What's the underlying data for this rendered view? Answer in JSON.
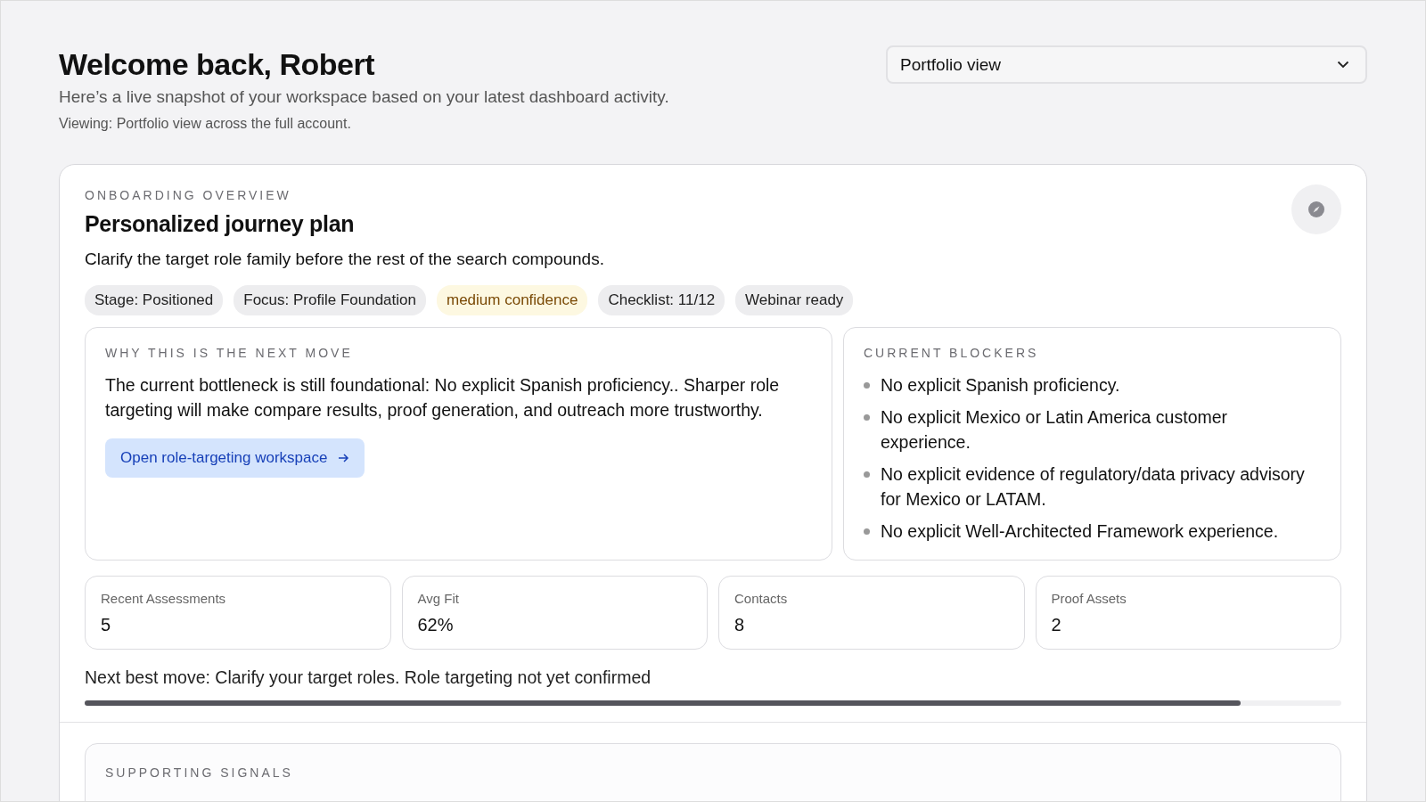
{
  "header": {
    "title": "Welcome back, Robert",
    "subtitle": "Here’s a live snapshot of your workspace based on your latest dashboard activity.",
    "viewing": "Viewing: Portfolio view across the full account."
  },
  "view_select": {
    "value": "Portfolio view"
  },
  "overview": {
    "eyebrow": "ONBOARDING OVERVIEW",
    "title": "Personalized journey plan",
    "summary": "Clarify the target role family before the rest of the search compounds.",
    "tags": [
      {
        "label": "Stage: Positioned",
        "kind": "neutral"
      },
      {
        "label": "Focus: Profile Foundation",
        "kind": "neutral"
      },
      {
        "label": "medium confidence",
        "kind": "warning"
      },
      {
        "label": "Checklist: 11/12",
        "kind": "neutral"
      },
      {
        "label": "Webinar ready",
        "kind": "neutral"
      }
    ],
    "why": {
      "eyebrow": "WHY THIS IS THE NEXT MOVE",
      "text": "The current bottleneck is still foundational: No explicit Spanish proficiency.. Sharper role targeting will make compare results, proof generation, and outreach more trustworthy.",
      "button": "Open role-targeting workspace"
    },
    "blockers": {
      "eyebrow": "CURRENT BLOCKERS",
      "items": [
        "No explicit Spanish proficiency.",
        "No explicit Mexico or Latin America customer experience.",
        "No explicit evidence of regulatory/data privacy advisory for Mexico or LATAM.",
        "No explicit Well-Architected Framework experience."
      ]
    },
    "stats": [
      {
        "label": "Recent Assessments",
        "value": "5"
      },
      {
        "label": "Avg Fit",
        "value": "62%"
      },
      {
        "label": "Contacts",
        "value": "8"
      },
      {
        "label": "Proof Assets",
        "value": "2"
      }
    ],
    "next_move": {
      "text": "Next best move: Clarify your target roles. Role targeting not yet confirmed",
      "level": 0.92
    }
  },
  "supporting": {
    "eyebrow": "SUPPORTING SIGNALS"
  }
}
